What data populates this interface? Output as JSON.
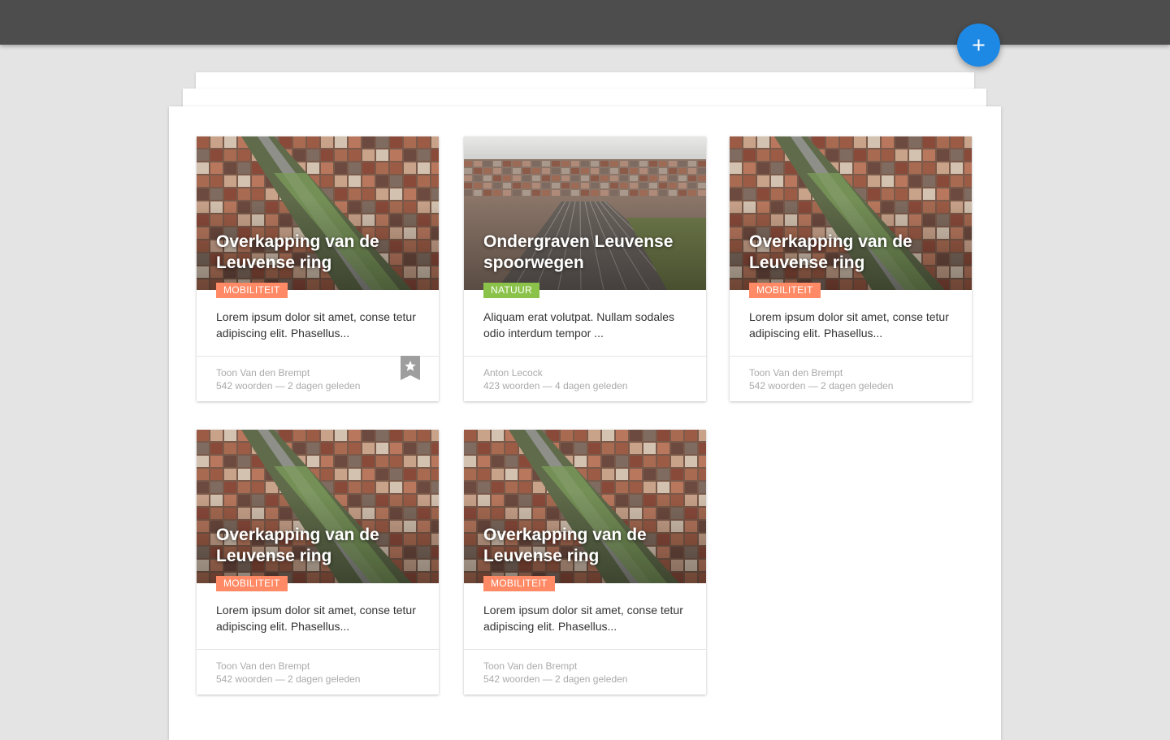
{
  "app": {
    "fab_icon": "plus-icon",
    "accent_color": "#1e88e5",
    "topbar_color": "#4d4d4d"
  },
  "tag_colors": {
    "MOBILITEIT": "#ff8a65",
    "NATUUR": "#8bc34a"
  },
  "cards": [
    {
      "title": "Overkapping van de Leuvense ring",
      "tag": "MOBILITEIT",
      "excerpt": "Lorem ipsum dolor sit amet, conse tetur adipiscing elit. Phasellus...",
      "author": "Toon Van den Brempt",
      "meta": "542 woorden — 2 dagen geleden",
      "image": "aerial-city-street",
      "bookmarked": true,
      "bookmark_icon": "star-bookmark-icon"
    },
    {
      "title": "Ondergraven Leuvense spoorwegen",
      "tag": "NATUUR",
      "excerpt": "Aliquam erat volutpat. Nullam sodales odio interdum tempor ...",
      "author": "Anton Lecock",
      "meta": "423 woorden — 4 dagen geleden",
      "image": "aerial-railway",
      "bookmarked": false
    },
    {
      "title": "Overkapping van de Leuvense ring",
      "tag": "MOBILITEIT",
      "excerpt": "Lorem ipsum dolor sit amet, conse tetur adipiscing elit. Phasellus...",
      "author": "Toon Van den Brempt",
      "meta": "542 woorden — 2 dagen geleden",
      "image": "aerial-city-street",
      "bookmarked": false
    },
    {
      "title": "Overkapping van de Leuvense ring",
      "tag": "MOBILITEIT",
      "excerpt": "Lorem ipsum dolor sit amet, conse tetur adipiscing elit. Phasellus...",
      "author": "Toon Van den Brempt",
      "meta": "542 woorden — 2 dagen geleden",
      "image": "aerial-city-street",
      "bookmarked": false
    },
    {
      "title": "Overkapping van de Leuvense ring",
      "tag": "MOBILITEIT",
      "excerpt": "Lorem ipsum dolor sit amet, conse tetur adipiscing elit. Phasellus...",
      "author": "Toon Van den Brempt",
      "meta": "542 woorden — 2 dagen geleden",
      "image": "aerial-city-street",
      "bookmarked": false
    }
  ]
}
